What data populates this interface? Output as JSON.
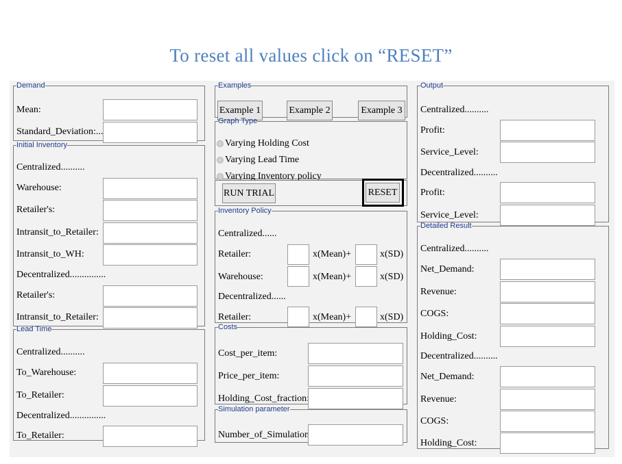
{
  "title": "To reset all values click on “RESET”",
  "demand": {
    "legend": "Demand",
    "mean": "Mean:",
    "sd": "Standard_Deviation:..."
  },
  "initial_inventory": {
    "legend": "Initial Inventory",
    "centralized": "Centralized..........",
    "warehouse": "Warehouse:",
    "retailers": "Retailer's:",
    "intransit_retailer": "Intransit_to_Retailer:",
    "intransit_wh": "Intransit_to_WH:",
    "decentralized": "Decentralized...............",
    "retailers2": "Retailer's:",
    "intransit_retailer2": "Intransit_to_Retailer:"
  },
  "lead_time": {
    "legend": "Lead Time",
    "centralized": "Centralized..........",
    "to_warehouse": "To_Warehouse:",
    "to_retailer": "To_Retailer:",
    "decentralized": "Decentralized...............",
    "to_retailer2": "To_Retailer:"
  },
  "examples": {
    "legend": "Examples",
    "ex1": "Example 1",
    "ex2": "Example 2",
    "ex3": "Example 3"
  },
  "graph_type": {
    "legend": "Graph Type",
    "opt1": "Varying Holding Cost",
    "opt2": "Varying Lead Time",
    "opt3": "Varying Inventory policy"
  },
  "actions": {
    "run": "RUN TRIAL",
    "reset": "RESET"
  },
  "inventory_policy": {
    "legend": "Inventory Policy",
    "centralized": "Centralized......",
    "retailer": "Retailer:",
    "warehouse": "Warehouse:",
    "decentralized": "Decentralized......",
    "retailer2": "Retailer:",
    "mean": "x(Mean)+",
    "sd": "x(SD)"
  },
  "costs": {
    "legend": "Costs",
    "cost": "Cost_per_item:",
    "price": "Price_per_item:",
    "holding": "Holding_Cost_fraction:."
  },
  "simulation": {
    "legend": "Simulation parameter",
    "num": "Number_of_Simulation:"
  },
  "output": {
    "legend": "Output",
    "centralized": "Centralized..........",
    "profit": "Profit:",
    "service": "Service_Level:",
    "decentralized": "Decentralized..........",
    "profit2": "Profit:",
    "service2": "Service_Level:"
  },
  "detailed": {
    "legend": "Detailed Result",
    "centralized": "Centralized..........",
    "net_demand": "Net_Demand:",
    "revenue": "Revenue:",
    "cogs": "COGS:",
    "holding": "Holding_Cost:",
    "decentralized": "Decentralized..........",
    "net_demand2": "Net_Demand:",
    "revenue2": "Revenue:",
    "cogs2": "COGS:",
    "holding2": "Holding_Cost:"
  }
}
